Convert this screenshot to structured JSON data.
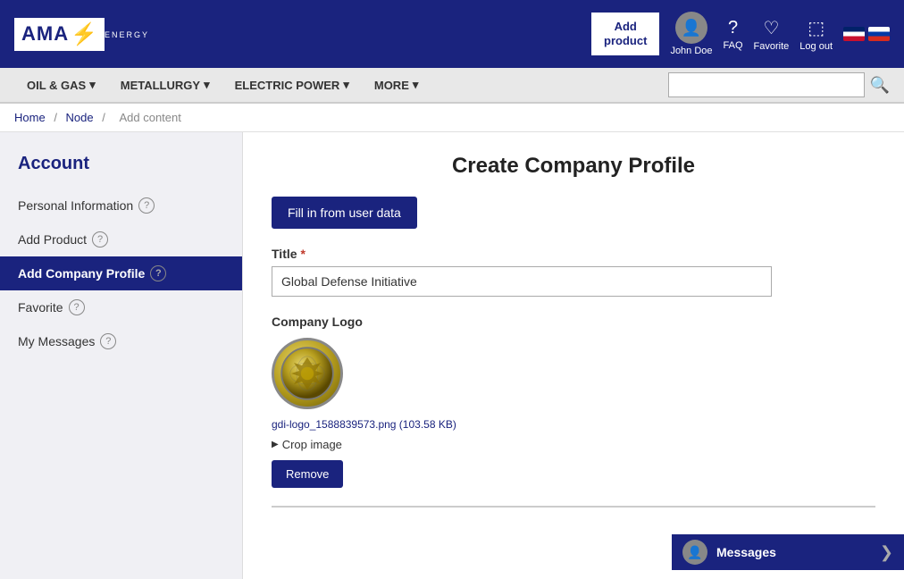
{
  "header": {
    "logo_text": "AMA",
    "logo_lightning": "⚡",
    "logo_sub": "ENERGY",
    "add_product_label": "Add\nproduct",
    "user_name": "John Doe",
    "faq_label": "FAQ",
    "favorite_label": "Favorite",
    "logout_label": "Log out"
  },
  "navbar": {
    "items": [
      {
        "label": "OIL & GAS",
        "has_arrow": true
      },
      {
        "label": "METALLURGY",
        "has_arrow": true
      },
      {
        "label": "ELECTRIC POWER",
        "has_arrow": true
      },
      {
        "label": "MORE",
        "has_arrow": true
      }
    ],
    "search_placeholder": ""
  },
  "breadcrumb": {
    "items": [
      "Home",
      "Node",
      "Add content"
    ]
  },
  "sidebar": {
    "title": "Account",
    "items": [
      {
        "label": "Personal Information",
        "has_help": true,
        "active": false
      },
      {
        "label": "Add Product",
        "has_help": true,
        "active": false
      },
      {
        "label": "Add Company Profile",
        "has_help": true,
        "active": true
      },
      {
        "label": "Favorite",
        "has_help": true,
        "active": false
      },
      {
        "label": "My Messages",
        "has_help": true,
        "active": false
      }
    ]
  },
  "content": {
    "page_title": "Create Company Profile",
    "fill_btn_label": "Fill in from user data",
    "title_label": "Title",
    "title_value": "Global Defense Initiative",
    "company_logo_label": "Company Logo",
    "file_info": "gdi-logo_1588839573.png (103.58 KB)",
    "crop_label": "Crop image",
    "remove_btn_label": "Remove"
  },
  "messages": {
    "label": "Messages"
  }
}
